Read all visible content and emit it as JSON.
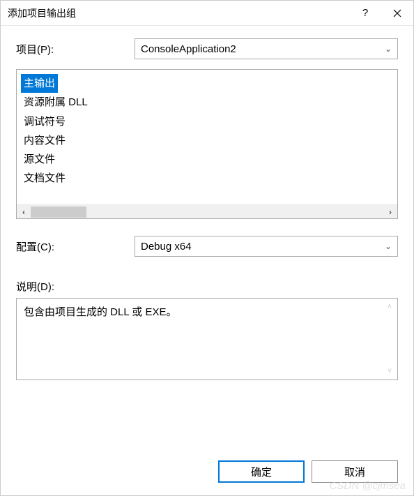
{
  "titlebar": {
    "title": "添加项目输出组"
  },
  "project": {
    "label": "项目(P):",
    "selected": "ConsoleApplication2"
  },
  "outputs": {
    "items": [
      {
        "label": "主输出",
        "selected": true
      },
      {
        "label": "资源附属 DLL",
        "selected": false
      },
      {
        "label": "调试符号",
        "selected": false
      },
      {
        "label": "内容文件",
        "selected": false
      },
      {
        "label": "源文件",
        "selected": false
      },
      {
        "label": "文档文件",
        "selected": false
      }
    ]
  },
  "configuration": {
    "label": "配置(C):",
    "selected": "Debug x64"
  },
  "description": {
    "label": "说明(D):",
    "text": "包含由项目生成的 DLL 或 EXE。"
  },
  "buttons": {
    "ok": "确定",
    "cancel": "取消"
  },
  "watermark": "CSDN @cjmsea"
}
